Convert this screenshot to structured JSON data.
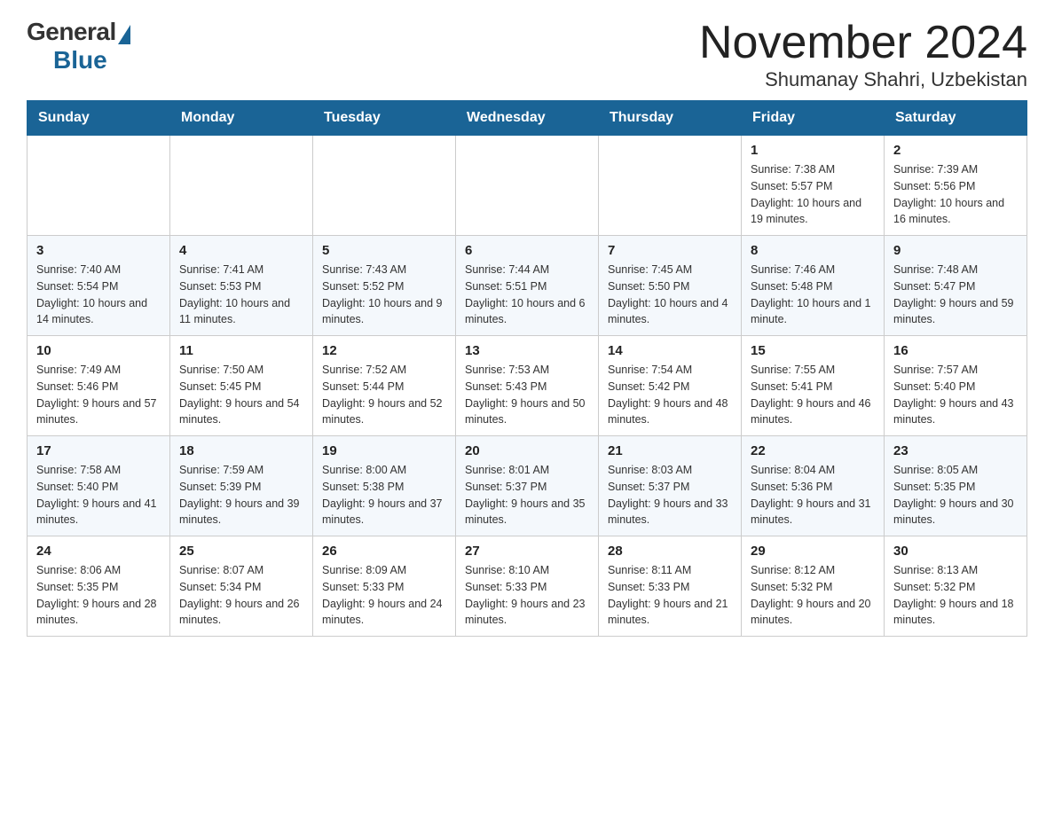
{
  "header": {
    "logo_general": "General",
    "logo_blue": "Blue",
    "month_title": "November 2024",
    "subtitle": "Shumanay Shahri, Uzbekistan"
  },
  "weekdays": [
    "Sunday",
    "Monday",
    "Tuesday",
    "Wednesday",
    "Thursday",
    "Friday",
    "Saturday"
  ],
  "rows": [
    [
      {
        "day": "",
        "sunrise": "",
        "sunset": "",
        "daylight": ""
      },
      {
        "day": "",
        "sunrise": "",
        "sunset": "",
        "daylight": ""
      },
      {
        "day": "",
        "sunrise": "",
        "sunset": "",
        "daylight": ""
      },
      {
        "day": "",
        "sunrise": "",
        "sunset": "",
        "daylight": ""
      },
      {
        "day": "",
        "sunrise": "",
        "sunset": "",
        "daylight": ""
      },
      {
        "day": "1",
        "sunrise": "Sunrise: 7:38 AM",
        "sunset": "Sunset: 5:57 PM",
        "daylight": "Daylight: 10 hours and 19 minutes."
      },
      {
        "day": "2",
        "sunrise": "Sunrise: 7:39 AM",
        "sunset": "Sunset: 5:56 PM",
        "daylight": "Daylight: 10 hours and 16 minutes."
      }
    ],
    [
      {
        "day": "3",
        "sunrise": "Sunrise: 7:40 AM",
        "sunset": "Sunset: 5:54 PM",
        "daylight": "Daylight: 10 hours and 14 minutes."
      },
      {
        "day": "4",
        "sunrise": "Sunrise: 7:41 AM",
        "sunset": "Sunset: 5:53 PM",
        "daylight": "Daylight: 10 hours and 11 minutes."
      },
      {
        "day": "5",
        "sunrise": "Sunrise: 7:43 AM",
        "sunset": "Sunset: 5:52 PM",
        "daylight": "Daylight: 10 hours and 9 minutes."
      },
      {
        "day": "6",
        "sunrise": "Sunrise: 7:44 AM",
        "sunset": "Sunset: 5:51 PM",
        "daylight": "Daylight: 10 hours and 6 minutes."
      },
      {
        "day": "7",
        "sunrise": "Sunrise: 7:45 AM",
        "sunset": "Sunset: 5:50 PM",
        "daylight": "Daylight: 10 hours and 4 minutes."
      },
      {
        "day": "8",
        "sunrise": "Sunrise: 7:46 AM",
        "sunset": "Sunset: 5:48 PM",
        "daylight": "Daylight: 10 hours and 1 minute."
      },
      {
        "day": "9",
        "sunrise": "Sunrise: 7:48 AM",
        "sunset": "Sunset: 5:47 PM",
        "daylight": "Daylight: 9 hours and 59 minutes."
      }
    ],
    [
      {
        "day": "10",
        "sunrise": "Sunrise: 7:49 AM",
        "sunset": "Sunset: 5:46 PM",
        "daylight": "Daylight: 9 hours and 57 minutes."
      },
      {
        "day": "11",
        "sunrise": "Sunrise: 7:50 AM",
        "sunset": "Sunset: 5:45 PM",
        "daylight": "Daylight: 9 hours and 54 minutes."
      },
      {
        "day": "12",
        "sunrise": "Sunrise: 7:52 AM",
        "sunset": "Sunset: 5:44 PM",
        "daylight": "Daylight: 9 hours and 52 minutes."
      },
      {
        "day": "13",
        "sunrise": "Sunrise: 7:53 AM",
        "sunset": "Sunset: 5:43 PM",
        "daylight": "Daylight: 9 hours and 50 minutes."
      },
      {
        "day": "14",
        "sunrise": "Sunrise: 7:54 AM",
        "sunset": "Sunset: 5:42 PM",
        "daylight": "Daylight: 9 hours and 48 minutes."
      },
      {
        "day": "15",
        "sunrise": "Sunrise: 7:55 AM",
        "sunset": "Sunset: 5:41 PM",
        "daylight": "Daylight: 9 hours and 46 minutes."
      },
      {
        "day": "16",
        "sunrise": "Sunrise: 7:57 AM",
        "sunset": "Sunset: 5:40 PM",
        "daylight": "Daylight: 9 hours and 43 minutes."
      }
    ],
    [
      {
        "day": "17",
        "sunrise": "Sunrise: 7:58 AM",
        "sunset": "Sunset: 5:40 PM",
        "daylight": "Daylight: 9 hours and 41 minutes."
      },
      {
        "day": "18",
        "sunrise": "Sunrise: 7:59 AM",
        "sunset": "Sunset: 5:39 PM",
        "daylight": "Daylight: 9 hours and 39 minutes."
      },
      {
        "day": "19",
        "sunrise": "Sunrise: 8:00 AM",
        "sunset": "Sunset: 5:38 PM",
        "daylight": "Daylight: 9 hours and 37 minutes."
      },
      {
        "day": "20",
        "sunrise": "Sunrise: 8:01 AM",
        "sunset": "Sunset: 5:37 PM",
        "daylight": "Daylight: 9 hours and 35 minutes."
      },
      {
        "day": "21",
        "sunrise": "Sunrise: 8:03 AM",
        "sunset": "Sunset: 5:37 PM",
        "daylight": "Daylight: 9 hours and 33 minutes."
      },
      {
        "day": "22",
        "sunrise": "Sunrise: 8:04 AM",
        "sunset": "Sunset: 5:36 PM",
        "daylight": "Daylight: 9 hours and 31 minutes."
      },
      {
        "day": "23",
        "sunrise": "Sunrise: 8:05 AM",
        "sunset": "Sunset: 5:35 PM",
        "daylight": "Daylight: 9 hours and 30 minutes."
      }
    ],
    [
      {
        "day": "24",
        "sunrise": "Sunrise: 8:06 AM",
        "sunset": "Sunset: 5:35 PM",
        "daylight": "Daylight: 9 hours and 28 minutes."
      },
      {
        "day": "25",
        "sunrise": "Sunrise: 8:07 AM",
        "sunset": "Sunset: 5:34 PM",
        "daylight": "Daylight: 9 hours and 26 minutes."
      },
      {
        "day": "26",
        "sunrise": "Sunrise: 8:09 AM",
        "sunset": "Sunset: 5:33 PM",
        "daylight": "Daylight: 9 hours and 24 minutes."
      },
      {
        "day": "27",
        "sunrise": "Sunrise: 8:10 AM",
        "sunset": "Sunset: 5:33 PM",
        "daylight": "Daylight: 9 hours and 23 minutes."
      },
      {
        "day": "28",
        "sunrise": "Sunrise: 8:11 AM",
        "sunset": "Sunset: 5:33 PM",
        "daylight": "Daylight: 9 hours and 21 minutes."
      },
      {
        "day": "29",
        "sunrise": "Sunrise: 8:12 AM",
        "sunset": "Sunset: 5:32 PM",
        "daylight": "Daylight: 9 hours and 20 minutes."
      },
      {
        "day": "30",
        "sunrise": "Sunrise: 8:13 AM",
        "sunset": "Sunset: 5:32 PM",
        "daylight": "Daylight: 9 hours and 18 minutes."
      }
    ]
  ]
}
